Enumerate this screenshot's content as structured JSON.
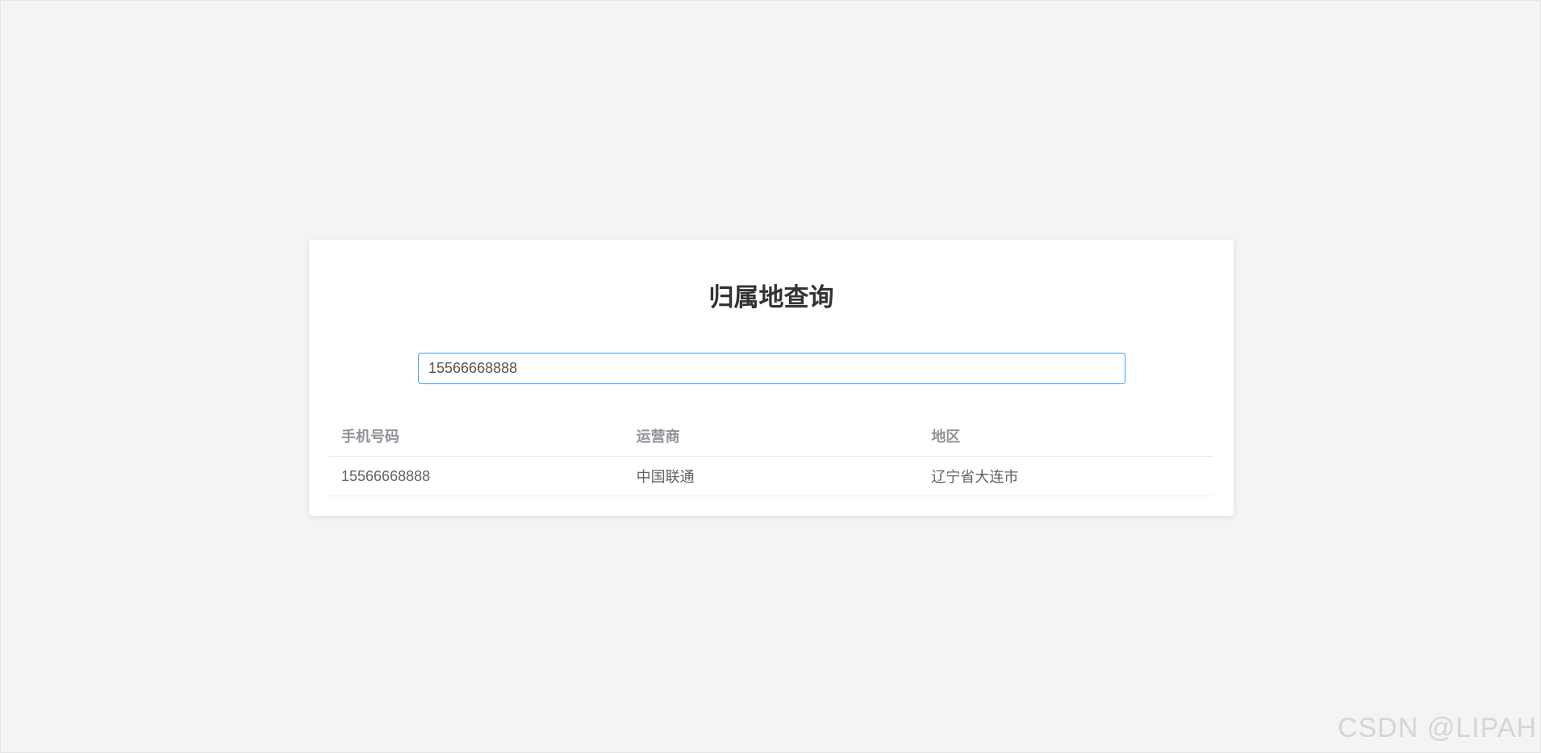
{
  "card": {
    "title": "归属地查询"
  },
  "search": {
    "value": "15566668888",
    "placeholder": ""
  },
  "table": {
    "columns": [
      "手机号码",
      "运营商",
      "地区"
    ],
    "rows": [
      [
        "15566668888",
        "中国联通",
        "辽宁省大连市"
      ]
    ]
  },
  "watermark": "CSDN @LIPAH",
  "colors": {
    "background": "#f4f4f4",
    "card": "#ffffff",
    "input_border_focus": "#409eff",
    "header_text": "#909399",
    "cell_text": "#606266"
  }
}
